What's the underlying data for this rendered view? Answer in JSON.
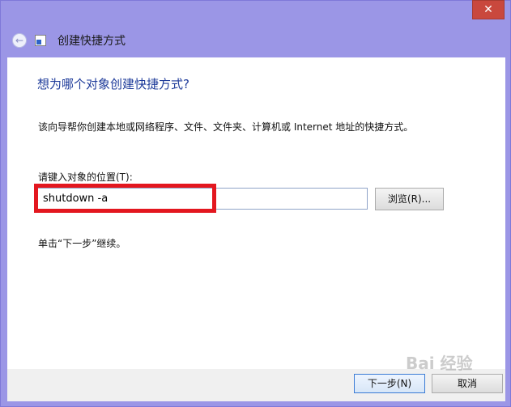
{
  "window": {
    "close_glyph": "✕",
    "title": "创建快捷方式",
    "back_glyph": "←",
    "icons": {
      "back": "back-arrow-icon",
      "shortcut": "shortcut-icon",
      "close": "close-icon"
    }
  },
  "main": {
    "heading": "想为哪个对象创建快捷方式?",
    "description": "该向导帮你创建本地或网络程序、文件、文件夹、计算机或 Internet 地址的快捷方式。",
    "field_label": "请键入对象的位置(T):",
    "location_value": "shutdown -a",
    "browse_label": "浏览(R)...",
    "hint": "单击“下一步”继续。"
  },
  "footer": {
    "next_label": "下一步(N)",
    "cancel_label": "取消"
  },
  "watermark": "Bai 经验",
  "colors": {
    "frame": "#9b96e6",
    "close_button": "#c9483d",
    "heading_text": "#1e3b9a",
    "highlight_box": "#e3171f"
  }
}
